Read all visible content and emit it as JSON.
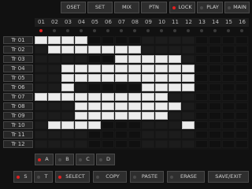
{
  "top_buttons": [
    {
      "label": "OSET",
      "led": false
    },
    {
      "label": "SET",
      "led": false
    },
    {
      "label": "MIX",
      "led": false
    },
    {
      "label": "PTN",
      "led": false
    },
    {
      "label": "LOCK",
      "led": true
    },
    {
      "label": "PLAY",
      "led": false
    },
    {
      "label": "MAIN",
      "led": false
    }
  ],
  "column_numbers": [
    "01",
    "02",
    "03",
    "04",
    "05",
    "06",
    "07",
    "08",
    "09",
    "10",
    "11",
    "12",
    "13",
    "14",
    "15",
    "16"
  ],
  "current_step": 1,
  "tracks": [
    {
      "label": "Tr 01",
      "steps": [
        1,
        1,
        1,
        1,
        0,
        0,
        0,
        0,
        0,
        0,
        0,
        0,
        0,
        0,
        0,
        0
      ]
    },
    {
      "label": "Tr 02",
      "steps": [
        0,
        1,
        1,
        1,
        1,
        1,
        1,
        1,
        0,
        0,
        0,
        0,
        0,
        0,
        0,
        0
      ]
    },
    {
      "label": "Tr 03",
      "steps": [
        0,
        0,
        0,
        0,
        0,
        0,
        1,
        1,
        1,
        1,
        1,
        0,
        0,
        0,
        0,
        0
      ]
    },
    {
      "label": "Tr 04",
      "steps": [
        0,
        0,
        1,
        1,
        1,
        1,
        1,
        1,
        1,
        1,
        1,
        1,
        0,
        0,
        0,
        0
      ]
    },
    {
      "label": "Tr 05",
      "steps": [
        0,
        0,
        1,
        1,
        1,
        1,
        1,
        1,
        1,
        1,
        1,
        1,
        0,
        0,
        0,
        0
      ]
    },
    {
      "label": "Tr 06",
      "steps": [
        0,
        0,
        1,
        0,
        0,
        0,
        0,
        0,
        1,
        1,
        1,
        1,
        0,
        0,
        0,
        0
      ]
    },
    {
      "label": "Tr 07",
      "steps": [
        1,
        1,
        1,
        1,
        1,
        1,
        1,
        1,
        1,
        1,
        0,
        0,
        0,
        0,
        0,
        0
      ]
    },
    {
      "label": "Tr 08",
      "steps": [
        0,
        0,
        0,
        1,
        1,
        1,
        1,
        1,
        1,
        1,
        1,
        0,
        0,
        0,
        0,
        0
      ]
    },
    {
      "label": "Tr 09",
      "steps": [
        0,
        0,
        0,
        1,
        1,
        1,
        1,
        1,
        1,
        1,
        0,
        0,
        0,
        0,
        0,
        0
      ]
    },
    {
      "label": "Tr 10",
      "steps": [
        0,
        1,
        1,
        1,
        1,
        0,
        0,
        0,
        0,
        0,
        0,
        1,
        0,
        0,
        0,
        0
      ]
    },
    {
      "label": "Tr 11",
      "steps": [
        0,
        0,
        0,
        0,
        0,
        0,
        0,
        0,
        0,
        0,
        0,
        0,
        0,
        0,
        0,
        0
      ]
    },
    {
      "label": "Tr 12",
      "steps": [
        0,
        0,
        0,
        0,
        0,
        0,
        0,
        0,
        0,
        0,
        0,
        0,
        0,
        0,
        0,
        0
      ]
    }
  ],
  "bank_buttons": [
    {
      "label": "A",
      "led": true
    },
    {
      "label": "B",
      "led": false
    },
    {
      "label": "C",
      "led": false
    },
    {
      "label": "D",
      "led": false
    }
  ],
  "bottom_buttons": [
    {
      "label": "S",
      "led": true
    },
    {
      "label": "T",
      "led": false
    },
    {
      "label": "SELECT",
      "led": true
    },
    {
      "label": "COPY",
      "led": false
    },
    {
      "label": "PASTE",
      "led": false
    },
    {
      "label": "ERASE",
      "led": false
    },
    {
      "label": "SAVE/EXIT",
      "led": false
    }
  ]
}
